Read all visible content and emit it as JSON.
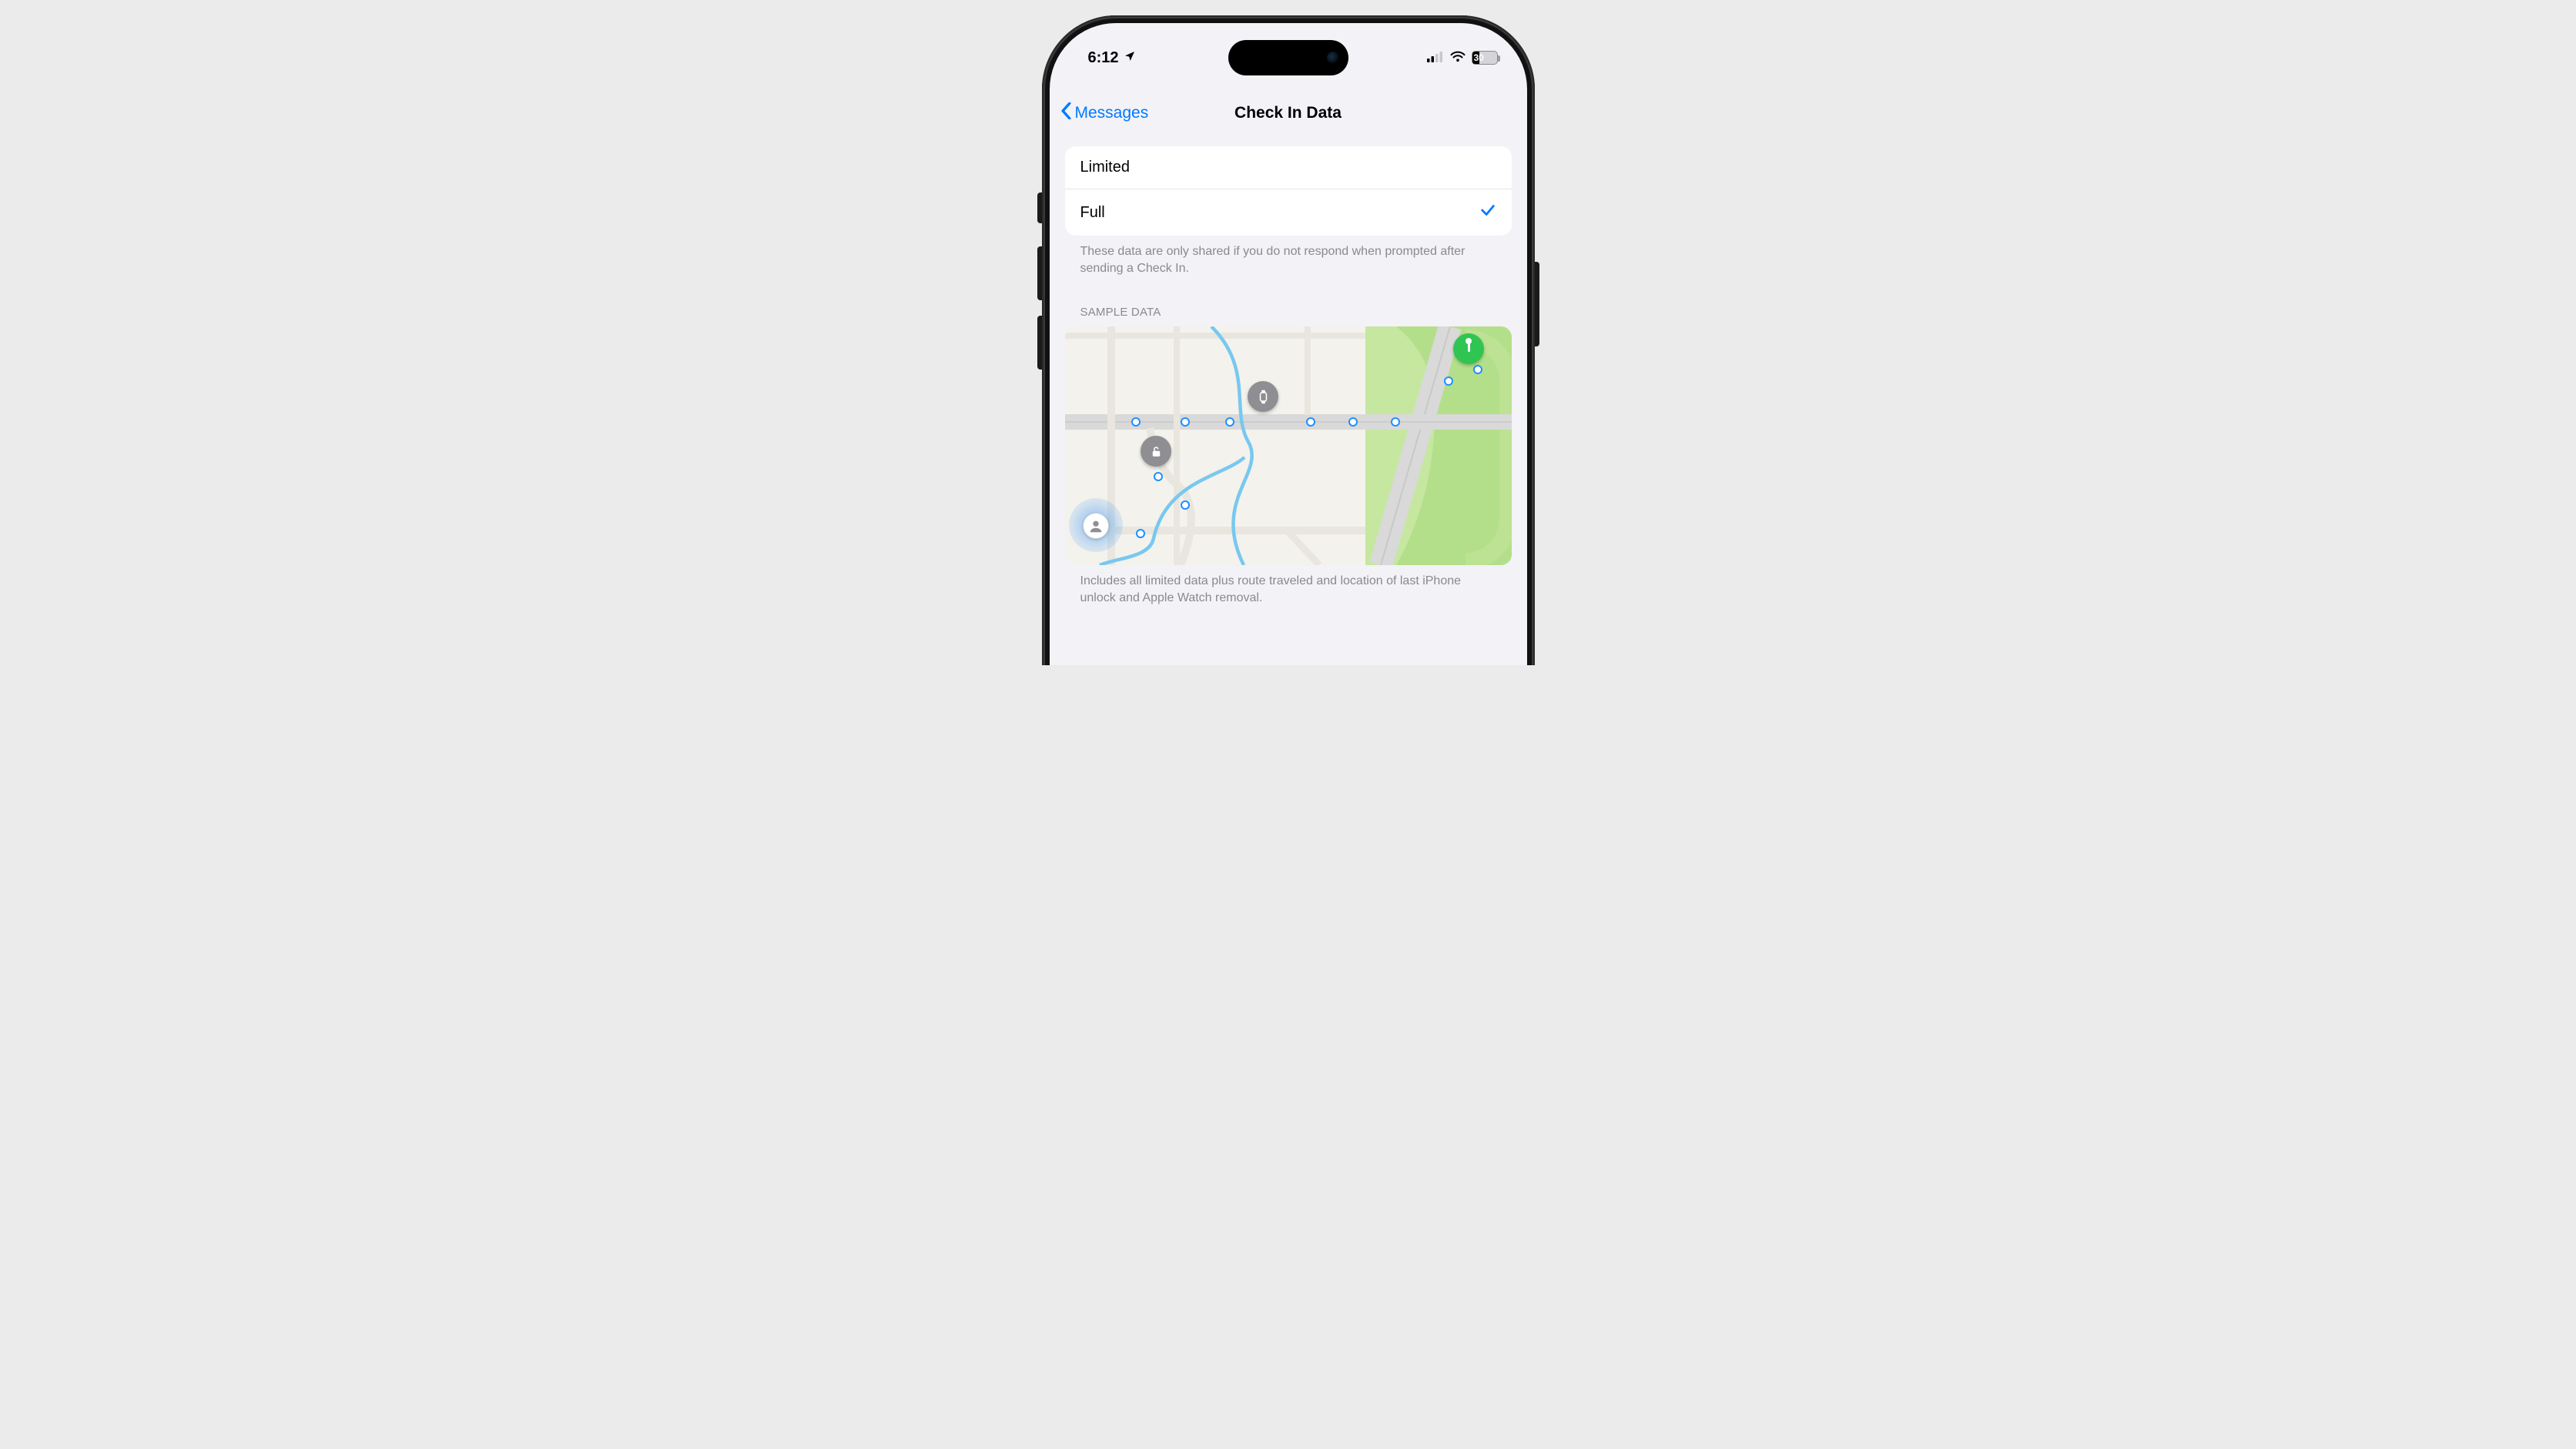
{
  "statusBar": {
    "time": "6:12",
    "batteryText": "30"
  },
  "nav": {
    "back": "Messages",
    "title": "Check In Data"
  },
  "options": {
    "limited": "Limited",
    "full": "Full",
    "footer": "These data are only shared if you do not respond when prompted after sending a Check In."
  },
  "sample": {
    "header": "SAMPLE DATA",
    "footer": "Includes all limited data plus route traveled and location of last iPhone unlock and Apple Watch removal."
  }
}
